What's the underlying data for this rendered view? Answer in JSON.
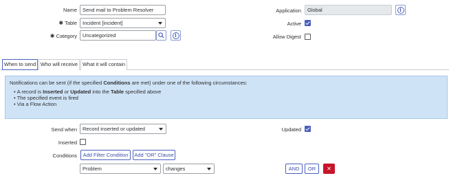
{
  "form": {
    "name_label": "Name",
    "name_value": "Send mail to Problem Resolver",
    "table_label": "Table",
    "table_value": "Incident [incident]",
    "category_label": "Category",
    "category_value": "Uncategorized",
    "required_mark": "✱",
    "application_label": "Application",
    "application_value": "Global",
    "active_label": "Active",
    "active_checked": true,
    "allow_digest_label": "Allow Digest",
    "allow_digest_checked": false
  },
  "tabs": [
    {
      "label": "When to send",
      "active": true
    },
    {
      "label": "Who will receive",
      "active": false
    },
    {
      "label": "What it will contain",
      "active": false
    }
  ],
  "info": {
    "intro_pre": "Notifications can be sent (if the specified ",
    "intro_bold": "Conditions",
    "intro_post": " are met) under one of the following circumstances:",
    "bullet1_pre": "A record is ",
    "bullet1_b1": "Inserted",
    "bullet1_mid1": " or ",
    "bullet1_b2": "Updated",
    "bullet1_mid2": " into the ",
    "bullet1_b3": "Table",
    "bullet1_post": " specified above",
    "bullet2": "The specified event is fired",
    "bullet3": "Via a Flow Action"
  },
  "when": {
    "send_when_label": "Send when",
    "send_when_value": "Record inserted or updated",
    "updated_label": "Updated",
    "updated_checked": true,
    "inserted_label": "Inserted",
    "inserted_checked": false,
    "conditions_label": "Conditions",
    "add_filter_label": "Add Filter Condition",
    "add_or_label": "Add \"OR\" Clause",
    "condition_field": "Problem",
    "condition_operator": "changes",
    "and_label": "AND",
    "or_label": "OR",
    "remove_label": "✕"
  },
  "icons": [
    "search-icon",
    "info-icon",
    "chevron-down-icon",
    "checkbox-checked-icon",
    "close-icon"
  ],
  "colors": {
    "accent": "#4a5fbd",
    "info_bg": "#cfe3f7",
    "danger": "#c7152b",
    "readonly_bg": "#e6e9eb"
  }
}
